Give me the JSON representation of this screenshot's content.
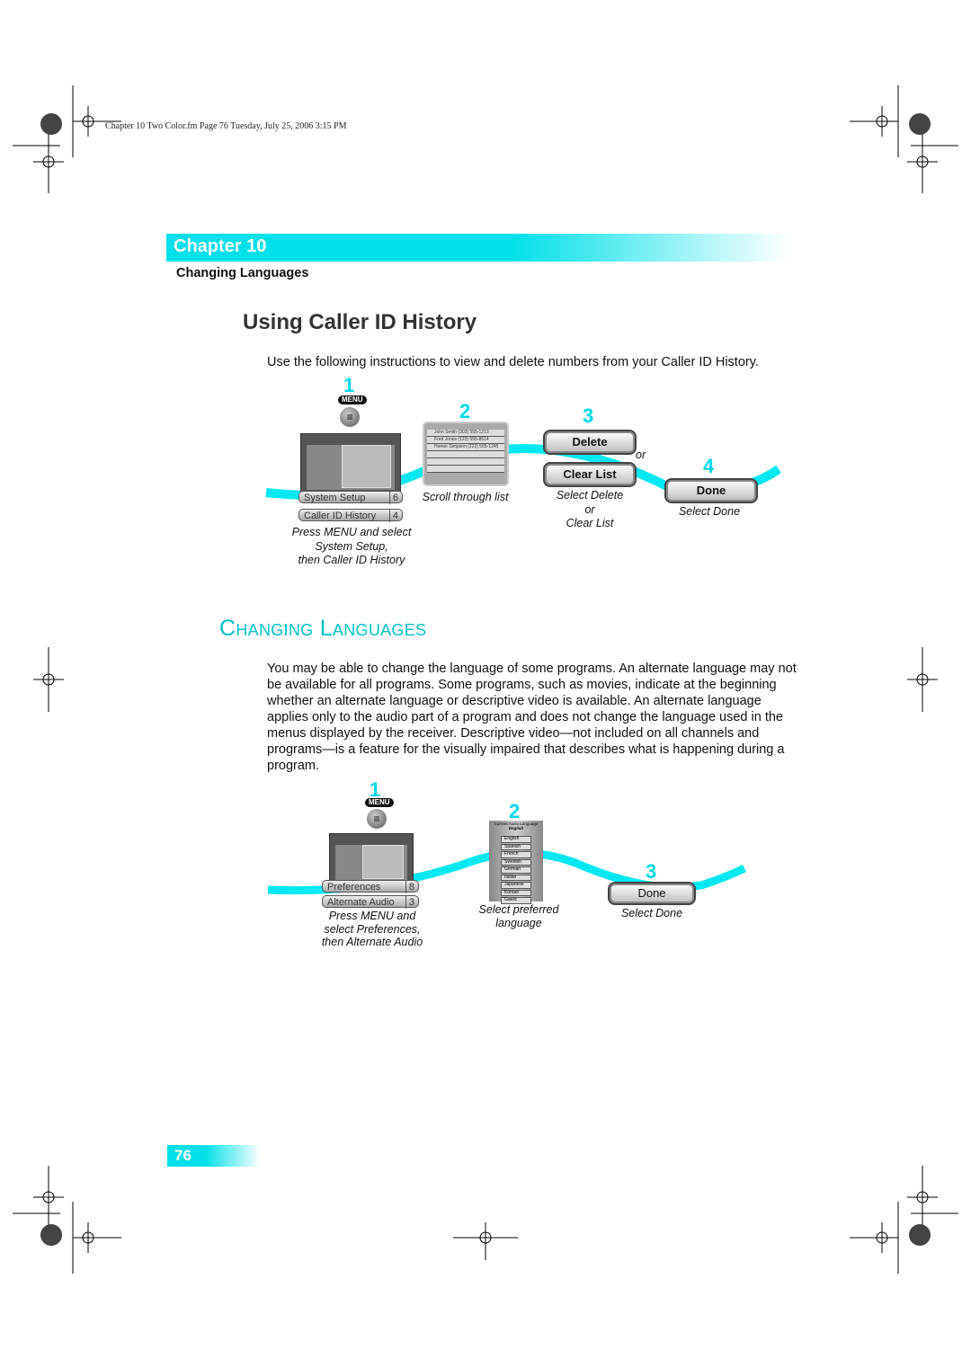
{
  "header": {
    "running_head": "Chapter 10 Two Color.fm  Page 76  Tuesday, July 25, 2006  3:15 PM"
  },
  "chapter": {
    "label": "Chapter 10",
    "subtitle": "Changing Languages"
  },
  "caller_id": {
    "title": "Using Caller ID History",
    "intro": "Use the following instructions to view and delete numbers from your Caller ID History.",
    "steps": [
      {
        "number": "1",
        "menu_label": "MENU",
        "menu_item_1": "System Setup",
        "menu_item_1_num": "6",
        "menu_item_2": "Caller ID History",
        "menu_item_2_num": "4",
        "caption": [
          "Press MENU and select",
          "System Setup,",
          "then Caller ID History"
        ]
      },
      {
        "number": "2",
        "list_rows": [
          "John Smith   (303) 555-1213",
          "Fred Jones   (123) 555-8514",
          "Homer Simpson   (222) 555-1245"
        ],
        "caption": "Scroll through list"
      },
      {
        "number": "3",
        "button_1": "Delete",
        "or": "or",
        "button_2": "Clear List",
        "caption": [
          "Select Delete",
          "or",
          "Clear List"
        ]
      },
      {
        "number": "4",
        "button": "Done",
        "caption": "Select Done"
      }
    ]
  },
  "languages": {
    "title": "Changing Languages",
    "body": "You may be able to change the language of some programs. An alternate language may not be available for all programs. Some programs, such as movies, indicate at the beginning whether an alternate language or descriptive video is available. An alternate language applies only to the audio part of a program and does not change the language used in the menus displayed by the receiver. Descriptive video—not included on all channels and programs—is a feature for the visually impaired that describes what is happening during a program.",
    "steps": [
      {
        "number": "1",
        "menu_label": "MENU",
        "menu_item_1": "Preferences",
        "menu_item_1_num": "8",
        "menu_item_2": "Alternate Audio",
        "menu_item_2_num": "3",
        "caption": [
          "Press MENU and",
          "select Preferences,",
          "then Alternate Audio"
        ]
      },
      {
        "number": "2",
        "screen_title": "Current Audio Language",
        "current": "English",
        "options": [
          "English",
          "Spanish",
          "French",
          "Swedish",
          "German",
          "Italian",
          "Japanese",
          "Korean",
          "Gaelic"
        ],
        "caption": [
          "Select preferred",
          "language"
        ]
      },
      {
        "number": "3",
        "button": "Done",
        "caption": "Select Done"
      }
    ]
  },
  "footer": {
    "page_number": "76"
  },
  "colors": {
    "accent": "#00e0e8",
    "heading": "#00c0c8"
  }
}
